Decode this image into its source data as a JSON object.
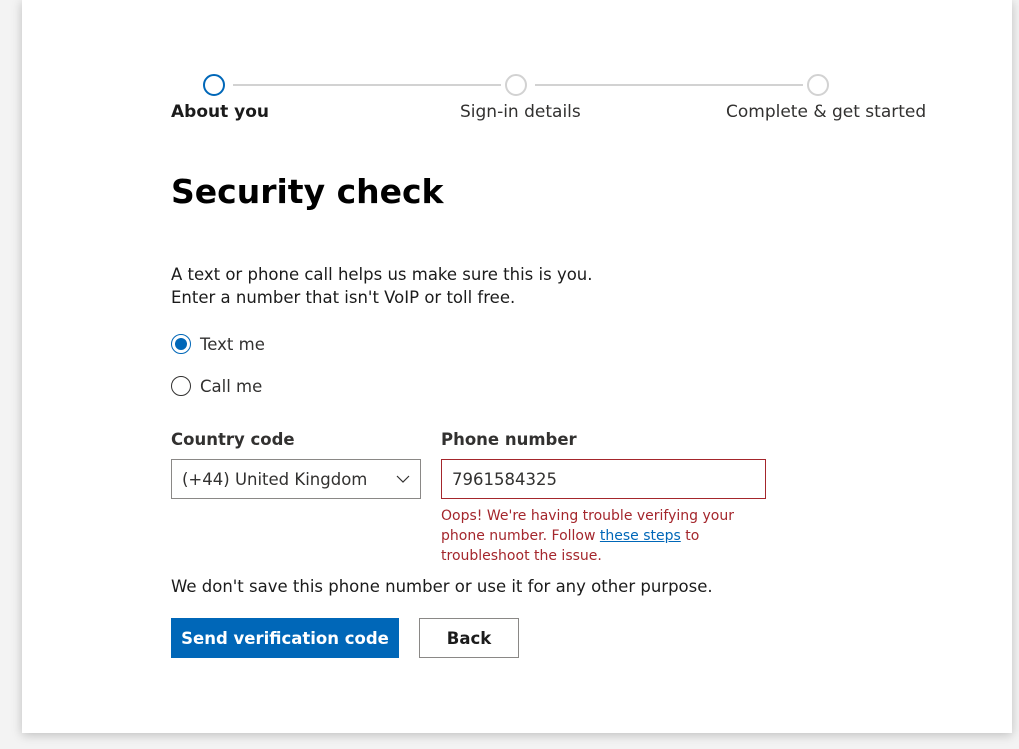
{
  "stepper": {
    "steps": [
      {
        "label": "About you",
        "state": "active"
      },
      {
        "label": "Sign-in details",
        "state": "pending"
      },
      {
        "label": "Complete & get started",
        "state": "pending"
      }
    ]
  },
  "page": {
    "title": "Security check",
    "intro_line1": "A text or phone call helps us make sure this is you.",
    "intro_line2": "Enter a number that isn't VoIP or toll free."
  },
  "verification_method": {
    "options": [
      {
        "label": "Text me",
        "checked": true
      },
      {
        "label": "Call me",
        "checked": false
      }
    ]
  },
  "country_code": {
    "label": "Country code",
    "selected": "(+44) United Kingdom"
  },
  "phone": {
    "label": "Phone number",
    "value": "7961584325",
    "error_before_link": "Oops! We're having trouble verifying your phone number. Follow ",
    "error_link": "these steps",
    "error_after_link": " to troubleshoot the issue."
  },
  "privacy_note": "We don't save this phone number or use it for any other purpose.",
  "actions": {
    "send_label": "Send verification code",
    "back_label": "Back"
  },
  "colors": {
    "accent": "#0067b8",
    "error": "#a4262c",
    "inactive_step": "#d2d2d2"
  },
  "icons": {
    "select_chevron": "chevron-down-icon"
  }
}
